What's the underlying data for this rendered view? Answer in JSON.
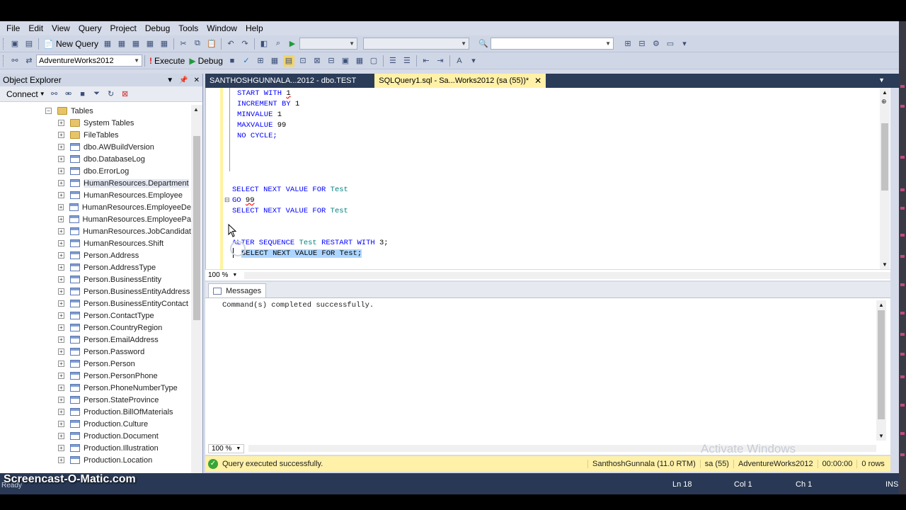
{
  "menu": [
    "File",
    "Edit",
    "View",
    "Query",
    "Project",
    "Debug",
    "Tools",
    "Window",
    "Help"
  ],
  "toolbar1": {
    "new_query_label": "New Query",
    "combo1_value": "",
    "combo2_value": "",
    "search_combo_value": ""
  },
  "toolbar2": {
    "database": "AdventureWorks2012",
    "execute_label": "Execute",
    "debug_label": "Debug"
  },
  "object_explorer": {
    "title": "Object Explorer",
    "connect_label": "Connect",
    "root": "Tables",
    "items": [
      {
        "label": "System Tables",
        "icon": "folder"
      },
      {
        "label": "FileTables",
        "icon": "folder"
      },
      {
        "label": "dbo.AWBuildVersion",
        "icon": "table"
      },
      {
        "label": "dbo.DatabaseLog",
        "icon": "table"
      },
      {
        "label": "dbo.ErrorLog",
        "icon": "table"
      },
      {
        "label": "HumanResources.Department",
        "icon": "table"
      },
      {
        "label": "HumanResources.Employee",
        "icon": "table"
      },
      {
        "label": "HumanResources.EmployeeDe",
        "icon": "table"
      },
      {
        "label": "HumanResources.EmployeePa",
        "icon": "table"
      },
      {
        "label": "HumanResources.JobCandidat",
        "icon": "table"
      },
      {
        "label": "HumanResources.Shift",
        "icon": "table"
      },
      {
        "label": "Person.Address",
        "icon": "table"
      },
      {
        "label": "Person.AddressType",
        "icon": "table"
      },
      {
        "label": "Person.BusinessEntity",
        "icon": "table"
      },
      {
        "label": "Person.BusinessEntityAddress",
        "icon": "table"
      },
      {
        "label": "Person.BusinessEntityContact",
        "icon": "table"
      },
      {
        "label": "Person.ContactType",
        "icon": "table"
      },
      {
        "label": "Person.CountryRegion",
        "icon": "table"
      },
      {
        "label": "Person.EmailAddress",
        "icon": "table"
      },
      {
        "label": "Person.Password",
        "icon": "table"
      },
      {
        "label": "Person.Person",
        "icon": "table"
      },
      {
        "label": "Person.PersonPhone",
        "icon": "table"
      },
      {
        "label": "Person.PhoneNumberType",
        "icon": "table"
      },
      {
        "label": "Person.StateProvince",
        "icon": "table"
      },
      {
        "label": "Production.BillOfMaterials",
        "icon": "table"
      },
      {
        "label": "Production.Culture",
        "icon": "table"
      },
      {
        "label": "Production.Document",
        "icon": "table"
      },
      {
        "label": "Production.Illustration",
        "icon": "table"
      },
      {
        "label": "Production.Location",
        "icon": "table"
      }
    ]
  },
  "tabs": [
    {
      "label": "SANTHOSHGUNNALA...2012 - dbo.TEST",
      "active": false
    },
    {
      "label": "SQLQuery1.sql - Sa...Works2012 (sa (55))*",
      "active": true
    }
  ],
  "editor": {
    "line_start_with": "START WITH",
    "val_start_with": "1",
    "line_increment_by": "INCREMENT BY",
    "val_increment_by": "1",
    "line_minvalue": "MINVALUE",
    "val_minvalue": "1",
    "line_maxvalue": "MAXVALUE",
    "val_maxvalue": "99",
    "line_no_cycle": "NO CYCLE;",
    "select_kw": "SELECT NEXT VALUE FOR",
    "seq_name": "Test",
    "go_kw": "GO",
    "go_count": "99",
    "alter_kw": "ALTER SEQUENCE",
    "restart_kw": "RESTART WITH",
    "restart_val": "3;",
    "selected_line": "SELECT NEXT VALUE FOR Test;",
    "zoom": "100 %"
  },
  "results": {
    "tab_label": "Messages",
    "message": "Command(s) completed successfully.",
    "zoom": "100 %"
  },
  "query_status": {
    "message": "Query executed successfully.",
    "server": "SanthoshGunnala (11.0 RTM)",
    "user": "sa (55)",
    "database": "AdventureWorks2012",
    "time": "00:00:00",
    "rows": "0 rows"
  },
  "status_bar": {
    "ready": "Ready",
    "ln": "Ln 18",
    "col": "Col 1",
    "ch": "Ch 1",
    "ins": "INS"
  },
  "watermarks": {
    "activate": "Activate Windows",
    "screencast": "Screencast-O-Matic.com"
  }
}
